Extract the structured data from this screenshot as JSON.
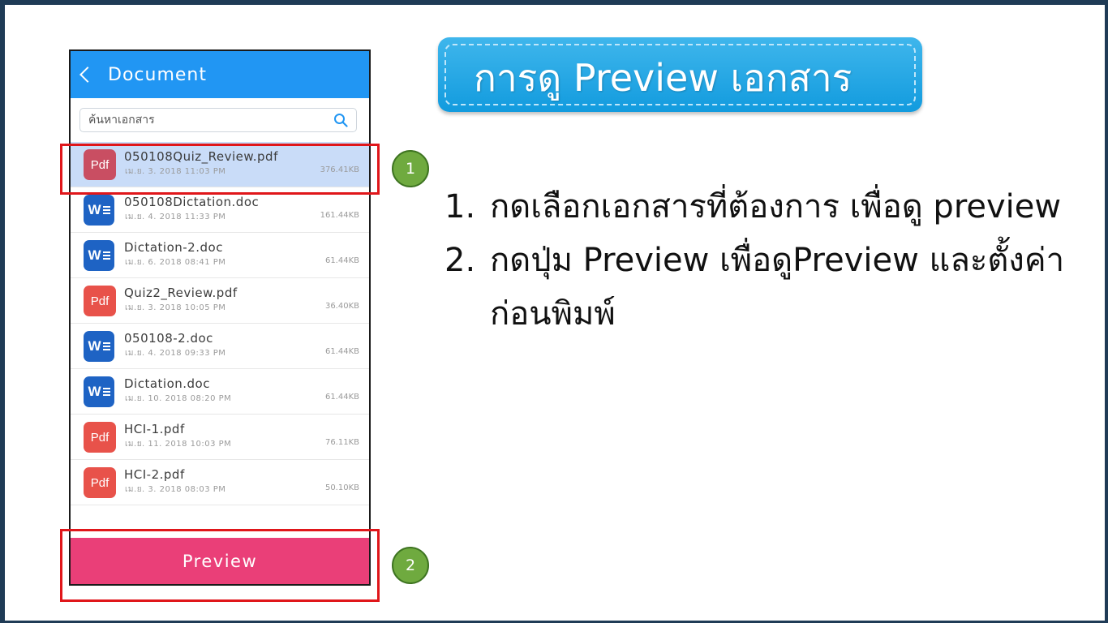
{
  "app": {
    "title": "Document",
    "search_placeholder": "ค้นหาเอกสาร",
    "preview_label": "Preview"
  },
  "files": [
    {
      "name": "050108Quiz_Review.pdf",
      "date": "เม.ย. 3. 2018 11:03 PM",
      "size": "376.41KB",
      "type": "pdf",
      "selected": true
    },
    {
      "name": "050108Dictation.doc",
      "date": "เม.ย. 4. 2018 11:33 PM",
      "size": "161.44KB",
      "type": "word",
      "selected": false
    },
    {
      "name": "Dictation-2.doc",
      "date": "เม.ย. 6. 2018 08:41 PM",
      "size": "61.44KB",
      "type": "word",
      "selected": false
    },
    {
      "name": "Quiz2_Review.pdf",
      "date": "เม.ย. 3. 2018 10:05 PM",
      "size": "36.40KB",
      "type": "pdf",
      "selected": false
    },
    {
      "name": "050108-2.doc",
      "date": "เม.ย. 4. 2018 09:33 PM",
      "size": "61.44KB",
      "type": "word",
      "selected": false
    },
    {
      "name": "Dictation.doc",
      "date": "เม.ย. 10. 2018 08:20 PM",
      "size": "61.44KB",
      "type": "word",
      "selected": false
    },
    {
      "name": "HCI-1.pdf",
      "date": "เม.ย. 11. 2018 10:03 PM",
      "size": "76.11KB",
      "type": "pdf",
      "selected": false
    },
    {
      "name": "HCI-2.pdf",
      "date": "เม.ย. 3. 2018 08:03 PM",
      "size": "50.10KB",
      "type": "pdf",
      "selected": false
    }
  ],
  "icons": {
    "pdf_label": "Pdf",
    "word_label": "W"
  },
  "badges": {
    "one": "1",
    "two": "2"
  },
  "slide": {
    "title": "การดู Preview เอกสาร",
    "steps": [
      {
        "num": "1.",
        "text": "กดเลือกเอกสารที่ต้องการ เพื่อดู preview"
      },
      {
        "num": "2.",
        "text": "กดปุ่ม Preview เพื่อดูPreview และตั้งค่าก่อนพิมพ์"
      }
    ]
  },
  "colors": {
    "header_blue": "#2196f3",
    "preview_pink": "#ea3f78",
    "highlight_red": "#e0161a",
    "badge_green": "#6faa3f"
  }
}
